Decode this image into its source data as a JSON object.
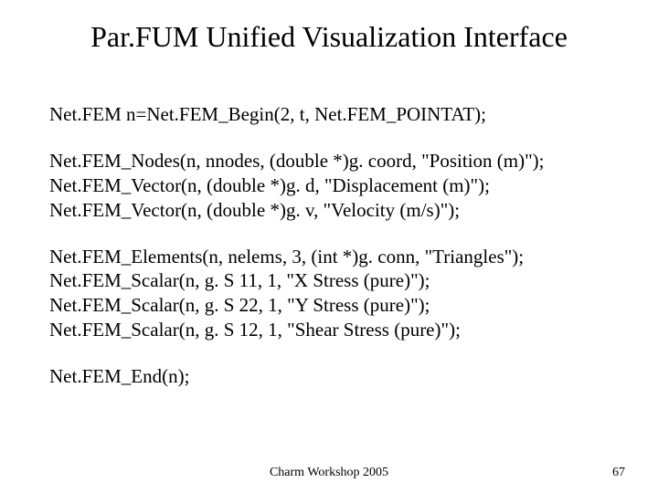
{
  "title": "Par.FUM Unified Visualization Interface",
  "code": {
    "begin": "Net.FEM n=Net.FEM_Begin(2, t, Net.FEM_POINTAT);",
    "nodes1": "Net.FEM_Nodes(n, nnodes, (double *)g. coord, \"Position (m)\");",
    "nodes2": "Net.FEM_Vector(n, (double *)g. d, \"Displacement (m)\");",
    "nodes3": "Net.FEM_Vector(n, (double *)g. v, \"Velocity (m/s)\");",
    "elems1": "Net.FEM_Elements(n, nelems, 3, (int *)g. conn, \"Triangles\");",
    "elems2": "Net.FEM_Scalar(n, g. S 11, 1, \"X Stress (pure)\");",
    "elems3": "Net.FEM_Scalar(n, g. S 22, 1, \"Y Stress (pure)\");",
    "elems4": "Net.FEM_Scalar(n, g. S 12, 1, \"Shear Stress (pure)\");",
    "end": "Net.FEM_End(n);"
  },
  "footer": {
    "center": "Charm Workshop 2005",
    "page": "67"
  }
}
